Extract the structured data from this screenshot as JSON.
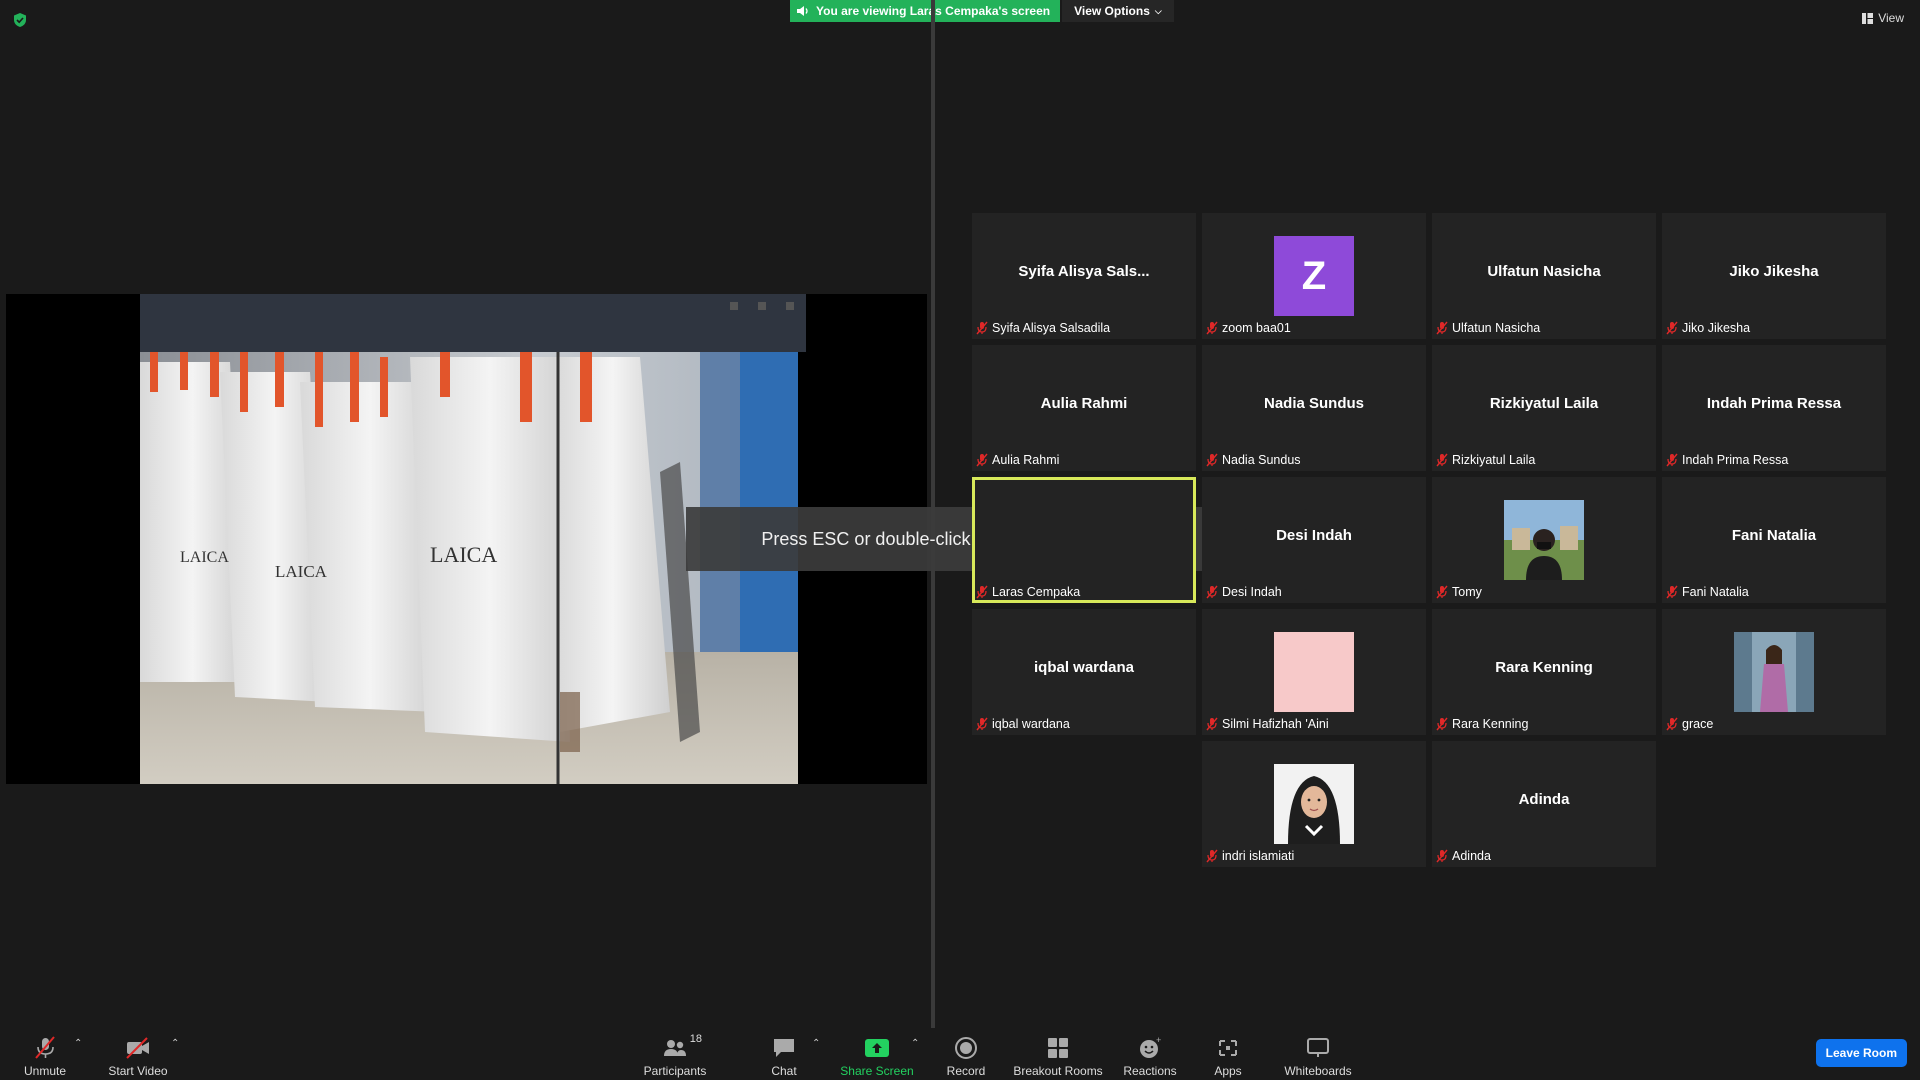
{
  "banner": {
    "viewing_text": "You are viewing Laras Cempaka's screen",
    "view_options": "View Options"
  },
  "top_right": {
    "view_label": "View"
  },
  "fullscreen_toast": "Press ESC or double-click to exit full screen mode",
  "colors": {
    "green": "#23b25a",
    "active_speaker": "#d8e95a",
    "leave": "#0e72ed",
    "muted_red": "#e02828"
  },
  "participants": [
    {
      "display": "Syifa  Alisya Sals...",
      "label": "Syifa Alisya Salsadila",
      "avatar": "none"
    },
    {
      "display": "Z",
      "label": "zoom baa01",
      "avatar": "letter"
    },
    {
      "display": "Ulfatun Nasicha",
      "label": "Ulfatun Nasicha",
      "avatar": "none"
    },
    {
      "display": "Jiko Jikesha",
      "label": "Jiko Jikesha",
      "avatar": "none"
    },
    {
      "display": "Aulia Rahmi",
      "label": "Aulia Rahmi",
      "avatar": "none"
    },
    {
      "display": "Nadia Sundus",
      "label": "Nadia Sundus",
      "avatar": "none"
    },
    {
      "display": "Rizkiyatul Laila",
      "label": "Rizkiyatul Laila",
      "avatar": "none"
    },
    {
      "display": "Indah Prima Ressa",
      "label": "Indah Prima Ressa",
      "avatar": "none"
    },
    {
      "display": "",
      "label": "Laras Cempaka",
      "avatar": "none"
    },
    {
      "display": "Desi Indah",
      "label": "Desi Indah",
      "avatar": "none"
    },
    {
      "display": "",
      "label": "Tomy",
      "avatar": "photo-outdoor"
    },
    {
      "display": "Fani Natalia",
      "label": "Fani Natalia",
      "avatar": "none"
    },
    {
      "display": "iqbal wardana",
      "label": "iqbal wardana",
      "avatar": "none"
    },
    {
      "display": "",
      "label": "Silmi Hafizhah 'Aini",
      "avatar": "pink-square"
    },
    {
      "display": "Rara Kenning",
      "label": "Rara Kenning",
      "avatar": "none"
    },
    {
      "display": "",
      "label": "grace",
      "avatar": "photo-portrait"
    },
    {
      "display": "",
      "label": "indri islamiati",
      "avatar": "photo-hijab"
    },
    {
      "display": "Adinda",
      "label": "Adinda",
      "avatar": "none"
    }
  ],
  "toolbar": {
    "unmute": "Unmute",
    "start_video": "Start Video",
    "participants": "Participants",
    "participants_count": "18",
    "chat": "Chat",
    "share_screen": "Share Screen",
    "record": "Record",
    "breakout_rooms": "Breakout Rooms",
    "reactions": "Reactions",
    "apps": "Apps",
    "whiteboards": "Whiteboards",
    "leave_room": "Leave Room"
  }
}
